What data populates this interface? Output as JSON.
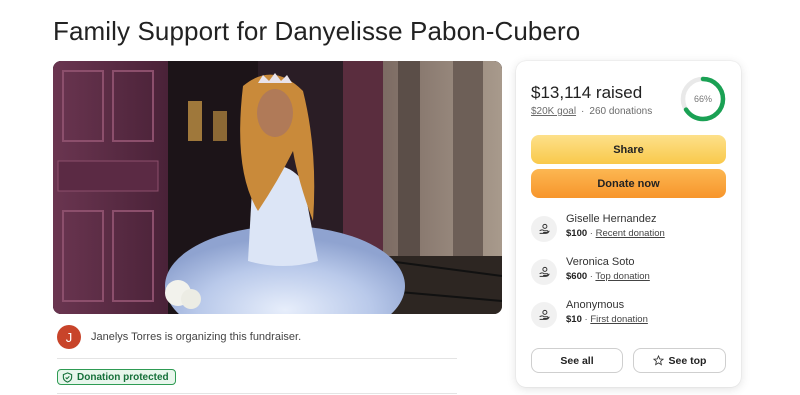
{
  "page": {
    "title": "Family Support for Danyelisse Pabon-Cubero"
  },
  "hero": {
    "image_icon": "photo-quinceanera"
  },
  "organizer": {
    "avatar_initial": "J",
    "text": "Janelys Torres is organizing this fundraiser."
  },
  "badge": {
    "label": "Donation protected",
    "icon": "shield-check-icon"
  },
  "summary": {
    "raised": "$13,114 raised",
    "goal": "$20K goal",
    "separator": "·",
    "donations": "260 donations",
    "progress_label": "66%",
    "progress_fraction": 0.66,
    "progress_color": "#1aa154"
  },
  "actions": {
    "share_label": "Share",
    "donate_label": "Donate now"
  },
  "donors": [
    {
      "name": "Giselle Hernandez",
      "amount": "$100",
      "dot": " · ",
      "tag": "Recent donation",
      "icon": "donation-hand-icon"
    },
    {
      "name": "Veronica Soto",
      "amount": "$600",
      "dot": " · ",
      "tag": "Top donation",
      "icon": "donation-hand-icon"
    },
    {
      "name": "Anonymous",
      "amount": "$10",
      "dot": " · ",
      "tag": "First donation",
      "icon": "donation-hand-icon"
    }
  ],
  "footer_buttons": {
    "see_all": "See all",
    "see_top": "See top",
    "see_top_icon": "star-icon"
  },
  "colors": {
    "share": "#f9c94b",
    "donate": "#f7952b",
    "badge_green": "#2e9b53",
    "avatar": "#c8442a"
  }
}
